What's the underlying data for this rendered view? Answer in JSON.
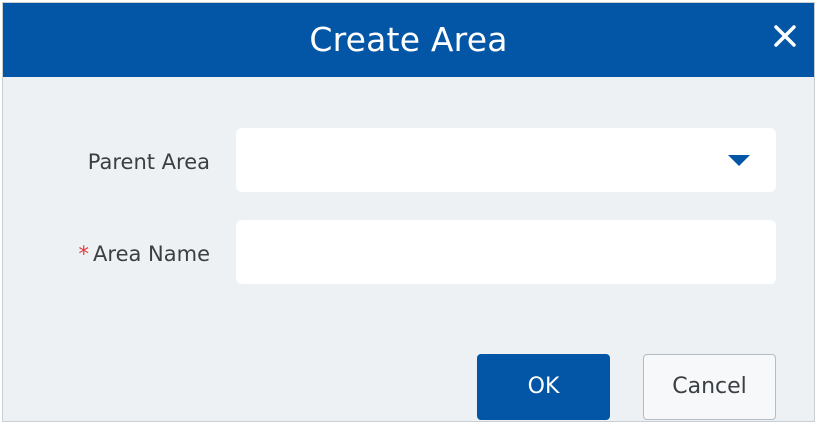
{
  "dialog": {
    "title": "Create Area",
    "close_icon": "close-icon"
  },
  "form": {
    "parent_area": {
      "label": "Parent Area",
      "value": "",
      "icon": "chevron-down-icon"
    },
    "area_name": {
      "required_marker": "*",
      "label": "Area Name",
      "value": "",
      "placeholder": ""
    }
  },
  "buttons": {
    "ok_label": "OK",
    "cancel_label": "Cancel"
  },
  "colors": {
    "primary": "#0356a6",
    "background": "#eef1f3",
    "required": "#e03a3a"
  }
}
